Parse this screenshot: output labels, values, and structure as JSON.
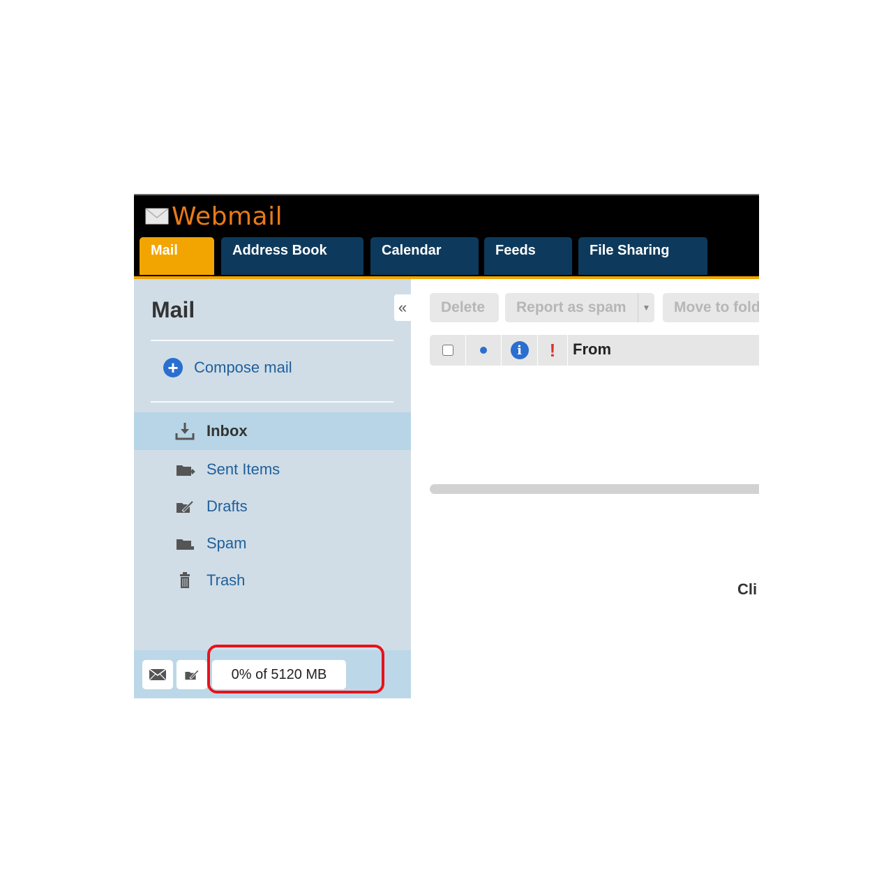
{
  "app": {
    "logo_text": "Webmail"
  },
  "tabs": [
    {
      "label": "Mail",
      "active": true
    },
    {
      "label": "Address Book",
      "active": false
    },
    {
      "label": "Calendar",
      "active": false
    },
    {
      "label": "Feeds",
      "active": false
    },
    {
      "label": "File Sharing",
      "active": false
    }
  ],
  "sidebar": {
    "title": "Mail",
    "collapse_icon": "«",
    "compose_label": "Compose mail",
    "folders": [
      {
        "label": "Inbox",
        "icon": "inbox-download-icon",
        "active": true
      },
      {
        "label": "Sent Items",
        "icon": "sent-folder-icon",
        "active": false
      },
      {
        "label": "Drafts",
        "icon": "drafts-folder-icon",
        "active": false
      },
      {
        "label": "Spam",
        "icon": "spam-folder-icon",
        "active": false
      },
      {
        "label": "Trash",
        "icon": "trash-icon",
        "active": false
      }
    ],
    "quota_text": "0% of 5120 MB",
    "quota_percent": 0
  },
  "toolbar": {
    "delete_label": "Delete",
    "report_spam_label": "Report as spam",
    "move_label": "Move to fold"
  },
  "list": {
    "from_label": "From",
    "flag_symbol": "!",
    "info_symbol": "i"
  },
  "main": {
    "partial_text": "Cli"
  },
  "colors": {
    "accent": "#f2a500",
    "header_bg": "#000000",
    "tab_bg": "#0d3a5c",
    "logo": "#e97a16",
    "link": "#1f5f9b",
    "highlight": "#e8121a"
  }
}
